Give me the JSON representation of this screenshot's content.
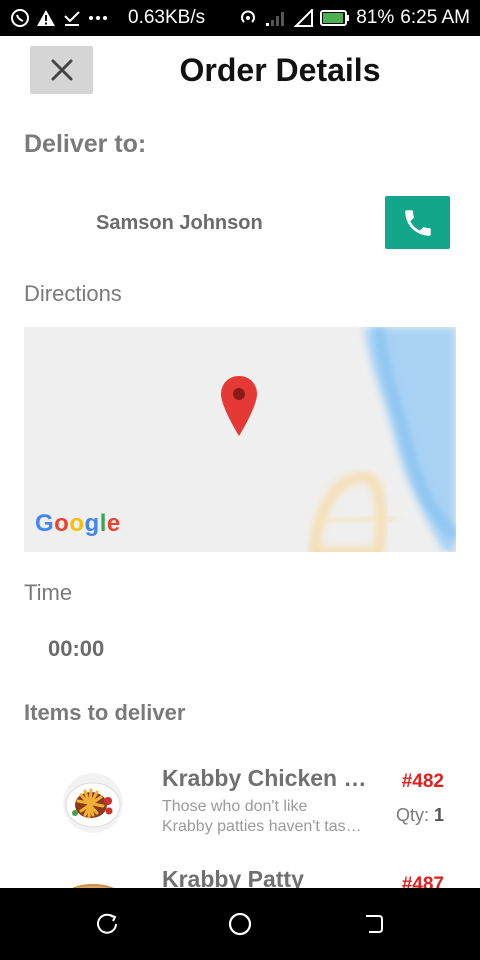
{
  "status_bar": {
    "net_speed": "0.63KB/s",
    "battery_pct": "81%",
    "time": "6:25 AM"
  },
  "header": {
    "title": "Order Details"
  },
  "deliver": {
    "label": "Deliver to:",
    "recipient": "Samson Johnson"
  },
  "directions": {
    "label": "Directions",
    "map_brand": "Google"
  },
  "time": {
    "label": "Time",
    "value": "00:00"
  },
  "items": {
    "label": "Items to deliver",
    "list": [
      {
        "name": "Krabby Chicken a…",
        "desc_line1": "Those who don't like",
        "desc_line2": "Krabby patties haven't tas…",
        "order_no": "#482",
        "qty_label": "Qty:",
        "qty": "1"
      },
      {
        "name": "Krabby Patty",
        "order_no": "#487"
      }
    ]
  },
  "colors": {
    "accent_call": "#12a68b",
    "order_red": "#e02020",
    "pin_red": "#e53935"
  }
}
